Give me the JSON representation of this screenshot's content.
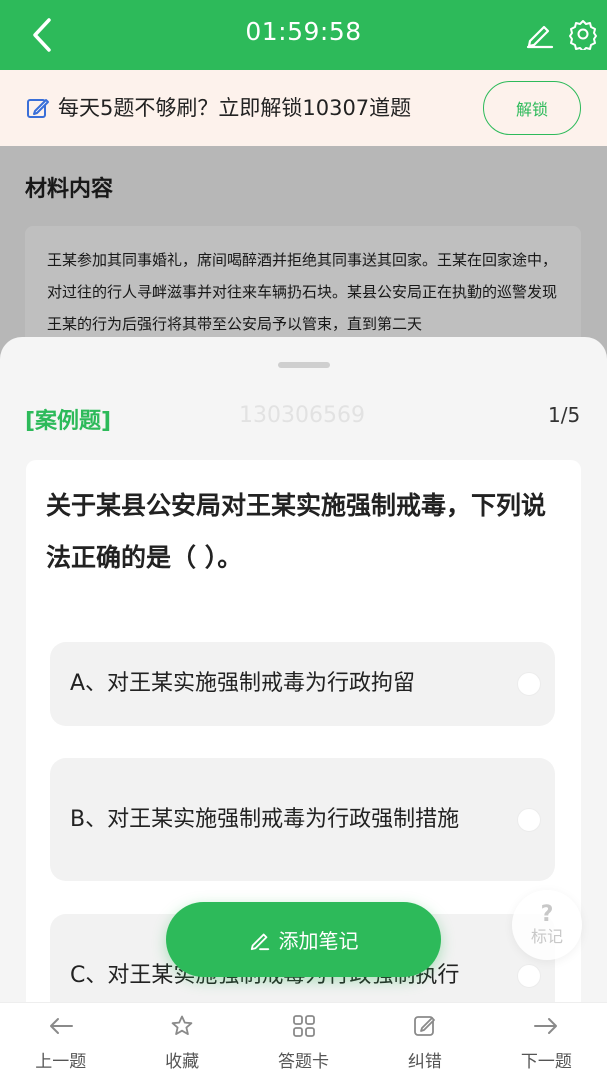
{
  "header": {
    "timer": "01:59:58",
    "back_icon": "chevron-left-icon",
    "edit_icon": "pencil-icon",
    "settings_icon": "gear-icon",
    "bg_color": "#2dba5a"
  },
  "promo": {
    "text": "每天5题不够刷？立即解锁10307道题",
    "unlock_label": "解锁",
    "icon": "edit-square-icon"
  },
  "material": {
    "title": "材料内容",
    "body": "王某参加其同事婚礼，席间喝醉酒并拒绝其同事送其回家。王某在回家途中，对过往的行人寻衅滋事并对往来车辆扔石块。某县公安局正在执勤的巡警发现王某的行为后强行将其带至公安局予以管束，直到第二天"
  },
  "question": {
    "type": "[案例题]",
    "id": "130306569",
    "progress": "1/5",
    "stem": "关于某县公安局对王某实施强制戒毒，下列说法正确的是（ ）。",
    "options": [
      {
        "label": "A、对王某实施强制戒毒为行政拘留"
      },
      {
        "label": "B、对王某实施强制戒毒为行政强制措施"
      },
      {
        "label": "C、对王某实施强制戒毒为行政强制执行"
      }
    ]
  },
  "note_button": {
    "label": "添加笔记",
    "icon": "pencil-icon"
  },
  "mark_button": {
    "symbol": "?",
    "label": "标记"
  },
  "bottom_nav": {
    "items": [
      {
        "label": "上一题",
        "icon": "arrow-left-icon"
      },
      {
        "label": "收藏",
        "icon": "star-icon"
      },
      {
        "label": "答题卡",
        "icon": "grid-icon"
      },
      {
        "label": "纠错",
        "icon": "edit-square-icon"
      },
      {
        "label": "下一题",
        "icon": "arrow-right-icon"
      }
    ]
  }
}
